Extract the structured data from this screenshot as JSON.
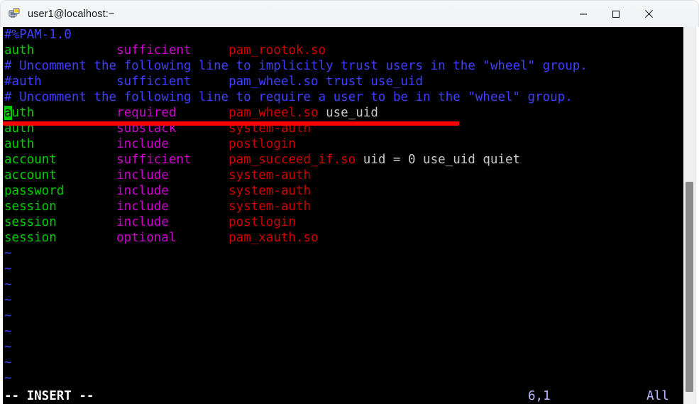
{
  "window": {
    "title": "user1@localhost:~",
    "app_icon": "terminal-computer-icon",
    "controls": {
      "minimize_label": "Minimize",
      "maximize_label": "Maximize",
      "close_label": "Close"
    }
  },
  "editor": {
    "name": "vim",
    "file_type": "pam-config",
    "status": {
      "mode": "-- INSERT --",
      "cursor_position": "6,1",
      "scroll_position": "All"
    },
    "cursor": {
      "line": 6,
      "column": 1,
      "char_under_cursor": "a"
    },
    "annotation": {
      "type": "red-underline",
      "color": "#ff0000",
      "target_line": 6
    },
    "colors": {
      "background": "#000000",
      "comment": "#3f3fff",
      "type": "#00cd00",
      "control": "#cd00cd",
      "module": "#cd0000",
      "plain": "#c8c8c8",
      "tilde": "#3f3fff",
      "cursor_block": "#00cd00"
    },
    "lines": [
      {
        "n": 1,
        "segments": [
          {
            "text": "#%PAM-1.0",
            "class": "c-comment"
          }
        ]
      },
      {
        "n": 2,
        "segments": [
          {
            "text": "auth",
            "class": "c-type"
          },
          {
            "text": "           ",
            "class": "c-plain"
          },
          {
            "text": "sufficient",
            "class": "c-ctrl"
          },
          {
            "text": "     ",
            "class": "c-plain"
          },
          {
            "text": "pam_rootok.so",
            "class": "c-str"
          }
        ]
      },
      {
        "n": 3,
        "segments": [
          {
            "text": "# Uncomment the following line to implicitly trust users in the \"wheel\" group.",
            "class": "c-comment"
          }
        ]
      },
      {
        "n": 4,
        "segments": [
          {
            "text": "#auth",
            "class": "c-comment"
          },
          {
            "text": "          sufficient     pam_wheel.so trust use_uid",
            "class": "c-comment"
          }
        ]
      },
      {
        "n": 5,
        "segments": [
          {
            "text": "# Uncomment the following line to require a user to be in the \"wheel\" group.",
            "class": "c-comment"
          }
        ]
      },
      {
        "n": 6,
        "cursor_at": 0,
        "segments": [
          {
            "text": "a",
            "class": "cursor"
          },
          {
            "text": "uth",
            "class": "c-type"
          },
          {
            "text": "           ",
            "class": "c-plain"
          },
          {
            "text": "required",
            "class": "c-ctrl"
          },
          {
            "text": "       ",
            "class": "c-plain"
          },
          {
            "text": "pam_wheel.so",
            "class": "c-str"
          },
          {
            "text": " use_uid",
            "class": "c-plain"
          }
        ]
      },
      {
        "n": 7,
        "segments": [
          {
            "text": "auth",
            "class": "c-type"
          },
          {
            "text": "           ",
            "class": "c-plain"
          },
          {
            "text": "substack",
            "class": "c-ctrl"
          },
          {
            "text": "       ",
            "class": "c-plain"
          },
          {
            "text": "system-auth",
            "class": "c-str"
          }
        ]
      },
      {
        "n": 8,
        "segments": [
          {
            "text": "auth",
            "class": "c-type"
          },
          {
            "text": "           ",
            "class": "c-plain"
          },
          {
            "text": "include",
            "class": "c-ctrl"
          },
          {
            "text": "        ",
            "class": "c-plain"
          },
          {
            "text": "postlogin",
            "class": "c-str"
          }
        ]
      },
      {
        "n": 9,
        "segments": [
          {
            "text": "account",
            "class": "c-type"
          },
          {
            "text": "        ",
            "class": "c-plain"
          },
          {
            "text": "sufficient",
            "class": "c-ctrl"
          },
          {
            "text": "     ",
            "class": "c-plain"
          },
          {
            "text": "pam_succeed_if.so",
            "class": "c-str"
          },
          {
            "text": " uid = 0 use_uid quiet",
            "class": "c-plain"
          }
        ]
      },
      {
        "n": 10,
        "segments": [
          {
            "text": "account",
            "class": "c-type"
          },
          {
            "text": "        ",
            "class": "c-plain"
          },
          {
            "text": "include",
            "class": "c-ctrl"
          },
          {
            "text": "        ",
            "class": "c-plain"
          },
          {
            "text": "system-auth",
            "class": "c-str"
          }
        ]
      },
      {
        "n": 11,
        "segments": [
          {
            "text": "password",
            "class": "c-type"
          },
          {
            "text": "       ",
            "class": "c-plain"
          },
          {
            "text": "include",
            "class": "c-ctrl"
          },
          {
            "text": "        ",
            "class": "c-plain"
          },
          {
            "text": "system-auth",
            "class": "c-str"
          }
        ]
      },
      {
        "n": 12,
        "segments": [
          {
            "text": "session",
            "class": "c-type"
          },
          {
            "text": "        ",
            "class": "c-plain"
          },
          {
            "text": "include",
            "class": "c-ctrl"
          },
          {
            "text": "        ",
            "class": "c-plain"
          },
          {
            "text": "system-auth",
            "class": "c-str"
          }
        ]
      },
      {
        "n": 13,
        "segments": [
          {
            "text": "session",
            "class": "c-type"
          },
          {
            "text": "        ",
            "class": "c-plain"
          },
          {
            "text": "include",
            "class": "c-ctrl"
          },
          {
            "text": "        ",
            "class": "c-plain"
          },
          {
            "text": "postlogin",
            "class": "c-str"
          }
        ]
      },
      {
        "n": 14,
        "segments": [
          {
            "text": "session",
            "class": "c-type"
          },
          {
            "text": "        ",
            "class": "c-plain"
          },
          {
            "text": "optional",
            "class": "c-ctrl"
          },
          {
            "text": "       ",
            "class": "c-plain"
          },
          {
            "text": "pam_xauth.so",
            "class": "c-str"
          }
        ]
      }
    ],
    "empty_line_marker": "~",
    "empty_line_count": 9
  },
  "scrollbar": {
    "orientation": "vertical",
    "thumb_label": "scroll-thumb"
  }
}
